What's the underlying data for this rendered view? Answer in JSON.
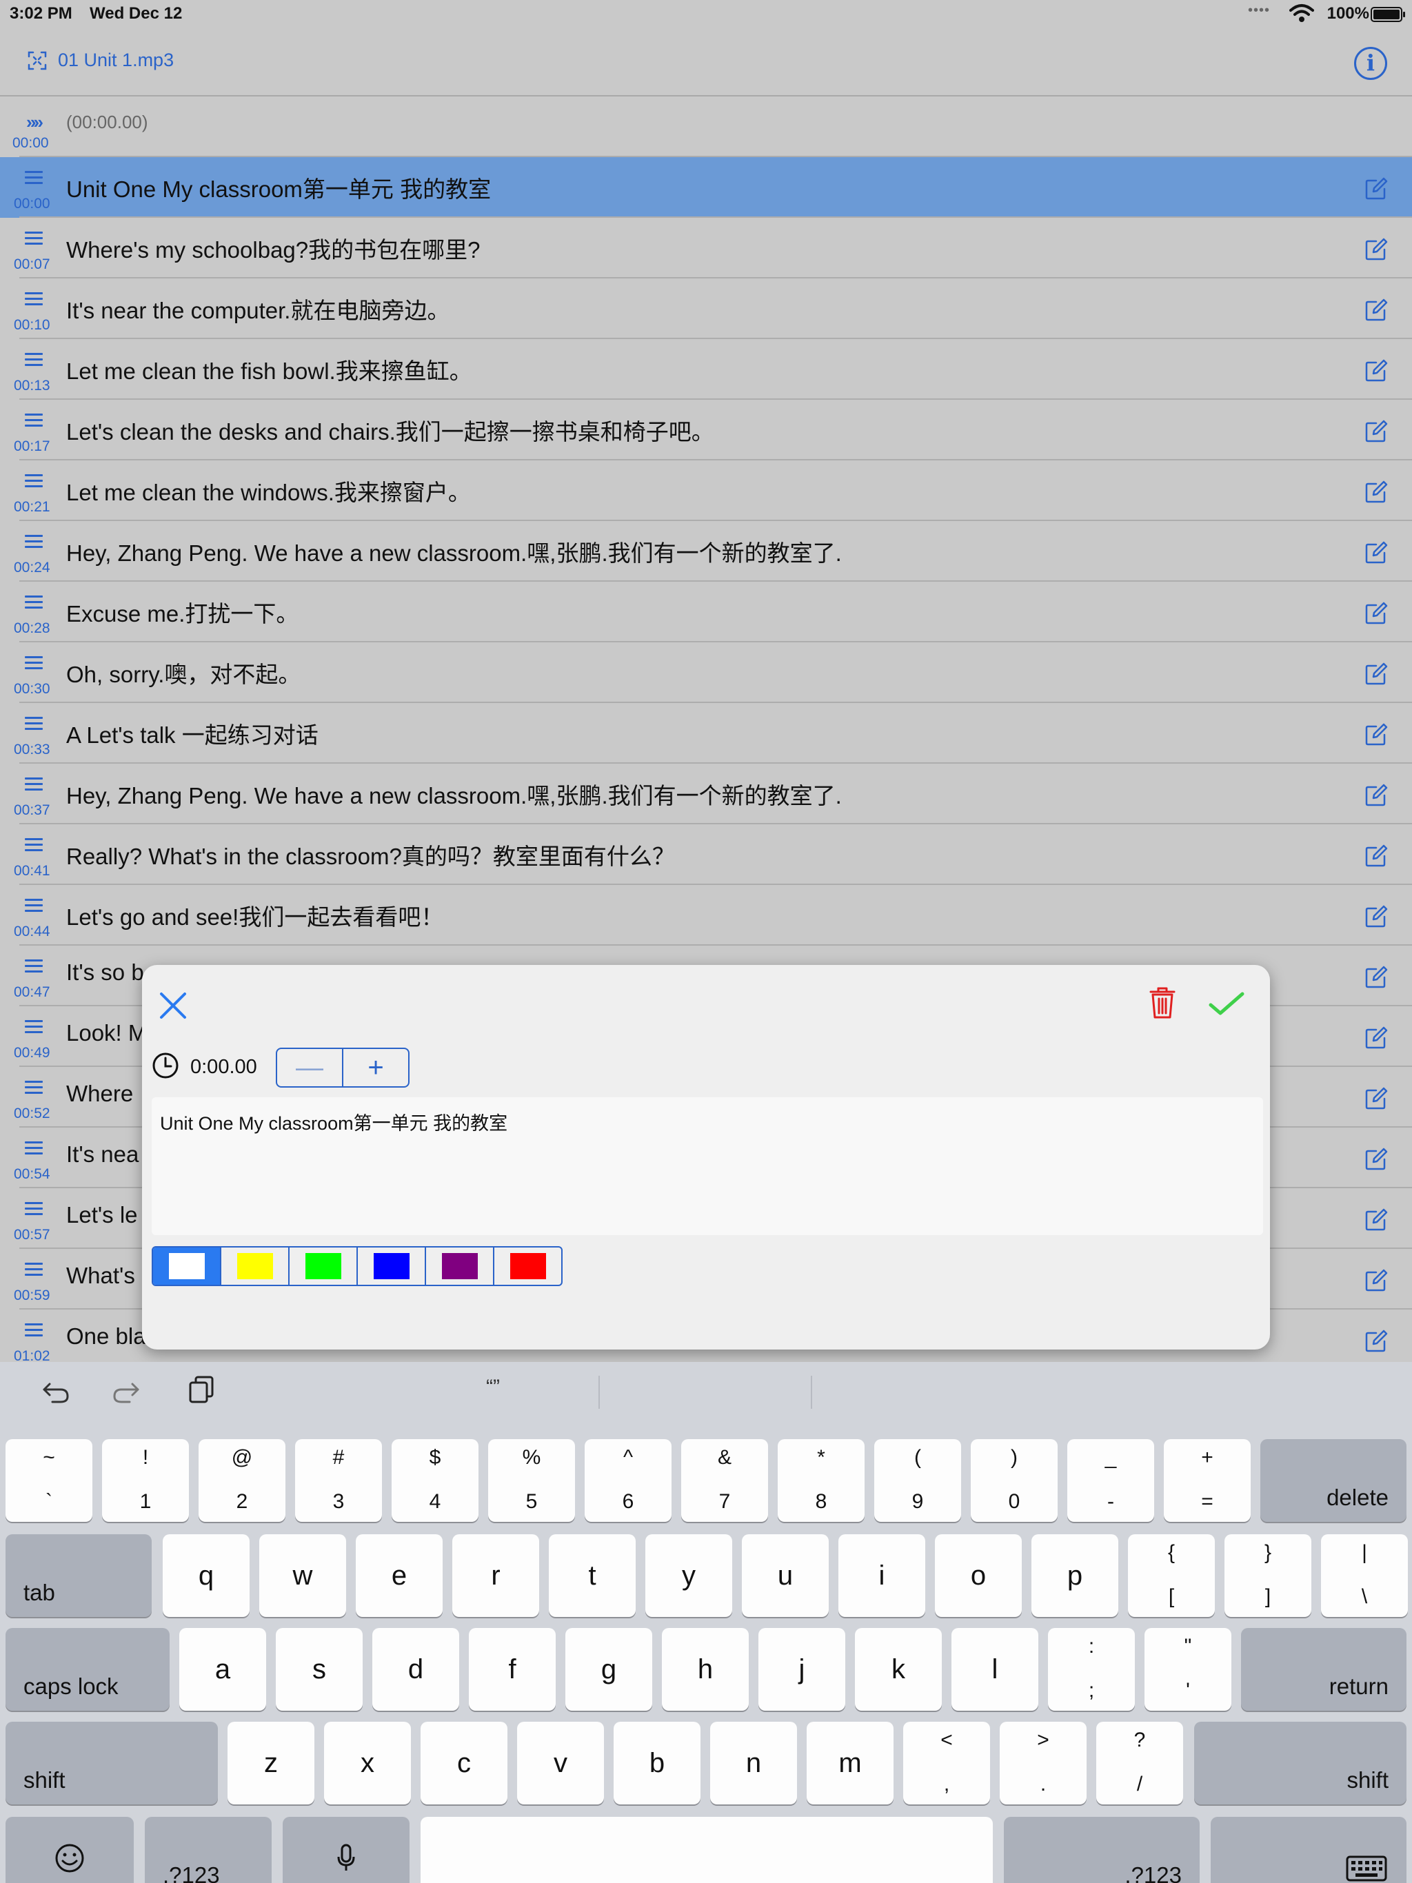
{
  "status_bar": {
    "time": "3:02 PM",
    "date": "Wed Dec 12",
    "signal": "••••",
    "battery": "100%"
  },
  "nav": {
    "title": "01 Unit 1.mp3"
  },
  "header_row": {
    "time": "00:00",
    "text": "(00:00.00)"
  },
  "rows": [
    {
      "time": "00:00",
      "text": "Unit One My classroom第一单元 我的教室",
      "selected": true
    },
    {
      "time": "00:07",
      "text": "Where's my schoolbag?我的书包在哪里?"
    },
    {
      "time": "00:10",
      "text": "It's near the computer.就在电脑旁边。"
    },
    {
      "time": "00:13",
      "text": "Let me clean the fish bowl.我来擦鱼缸。"
    },
    {
      "time": "00:17",
      "text": "Let's clean the desks and chairs.我们一起擦一擦书桌和椅子吧。"
    },
    {
      "time": "00:21",
      "text": "Let me clean the windows.我来擦窗户。"
    },
    {
      "time": "00:24",
      "text": "Hey, Zhang Peng. We have a new classroom.嘿,张鹏.我们有一个新的教室了."
    },
    {
      "time": "00:28",
      "text": "Excuse me.打扰一下。"
    },
    {
      "time": "00:30",
      "text": "Oh, sorry.噢，对不起。"
    },
    {
      "time": "00:33",
      "text": "A Let's talk 一起练习对话"
    },
    {
      "time": "00:37",
      "text": "Hey, Zhang Peng. We have a new classroom.嘿,张鹏.我们有一个新的教室了."
    },
    {
      "time": "00:41",
      "text": "Really? What's in the classroom?真的吗？教室里面有什么？"
    },
    {
      "time": "00:44",
      "text": "Let's go and see!我们一起去看看吧！"
    },
    {
      "time": "00:47",
      "text": "It's so b"
    },
    {
      "time": "00:49",
      "text": "Look! M"
    },
    {
      "time": "00:52",
      "text": "Where"
    },
    {
      "time": "00:54",
      "text": "It's nea"
    },
    {
      "time": "00:57",
      "text": "Let's le"
    },
    {
      "time": "00:59",
      "text": "What's"
    },
    {
      "time": "01:02",
      "text": "One bla"
    }
  ],
  "dialog": {
    "time_value": "0:00.00",
    "minus": "—",
    "plus": "+",
    "text": "Unit One My classroom第一单元 我的教室",
    "colors": [
      "#ffffff",
      "#ffff00",
      "#00ff00",
      "#0000ff",
      "#800080",
      "#ff0000"
    ],
    "selected_color_index": 0
  },
  "keyboard": {
    "suggestion": "“”",
    "number_row": [
      {
        "top": "~",
        "bot": "`"
      },
      {
        "top": "!",
        "bot": "1"
      },
      {
        "top": "@",
        "bot": "2"
      },
      {
        "top": "#",
        "bot": "3"
      },
      {
        "top": "$",
        "bot": "4"
      },
      {
        "top": "%",
        "bot": "5"
      },
      {
        "top": "^",
        "bot": "6"
      },
      {
        "top": "&",
        "bot": "7"
      },
      {
        "top": "*",
        "bot": "8"
      },
      {
        "top": "(",
        "bot": "9"
      },
      {
        "top": ")",
        "bot": "0"
      },
      {
        "top": "_",
        "bot": "-"
      },
      {
        "top": "+",
        "bot": "="
      }
    ],
    "delete": "delete",
    "tab": "tab",
    "row_q": [
      "q",
      "w",
      "e",
      "r",
      "t",
      "y",
      "u",
      "i",
      "o",
      "p"
    ],
    "row_q_sym": [
      {
        "top": "{",
        "bot": "["
      },
      {
        "top": "}",
        "bot": "]"
      },
      {
        "top": "|",
        "bot": "\\"
      }
    ],
    "caps_lock": "caps lock",
    "row_a": [
      "a",
      "s",
      "d",
      "f",
      "g",
      "h",
      "j",
      "k",
      "l"
    ],
    "row_a_sym": [
      {
        "top": ":",
        "bot": ";"
      },
      {
        "top": "\"",
        "bot": "'"
      }
    ],
    "return": "return",
    "shift": "shift",
    "row_z": [
      "z",
      "x",
      "c",
      "v",
      "b",
      "n",
      "m"
    ],
    "row_z_sym": [
      {
        "top": "<",
        "bot": ","
      },
      {
        "top": ">",
        "bot": "."
      },
      {
        "top": "?",
        "bot": "/"
      }
    ],
    "numbers": ".?123"
  }
}
